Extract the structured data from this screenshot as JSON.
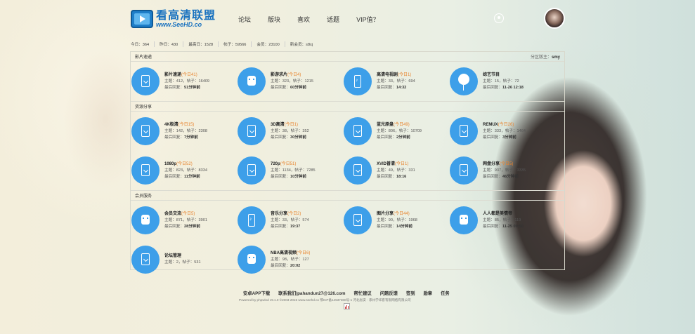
{
  "logo": {
    "cn": "看高清联盟",
    "en": "www.SeeHD.co"
  },
  "nav": [
    "论坛",
    "版块",
    "喜欢",
    "话题",
    "VIP值？"
  ],
  "stats": [
    "今日：364",
    "昨日：430",
    "最高日：1528",
    "帖子：59566",
    "会员：23100",
    "新会员：s8xj"
  ],
  "sections": [
    {
      "title": "影片速递",
      "moderator_label": "分区版主：",
      "moderator": "smy",
      "forums": [
        {
          "name": "影片速递",
          "today": "(今日41)",
          "counts": "主题：412，帖子：16409",
          "last_label": "最后回复：",
          "last": "51分钟前",
          "icon": "doc"
        },
        {
          "name": "影游求片",
          "today": "(今日4)",
          "counts": "主题：323，帖子：1215",
          "last_label": "最后回复：",
          "last": "60分钟前",
          "icon": "robot"
        },
        {
          "name": "高清电视剧",
          "today": "(今日1)",
          "counts": "主题：33，帖子：694",
          "last_label": "最后回复：",
          "last": "14:32",
          "icon": "phone"
        },
        {
          "name": "综艺节目",
          "today": "",
          "counts": "主题：15，帖子：72",
          "last_label": "最后回复：",
          "last": "11-26 12:18",
          "icon": "balloon"
        }
      ]
    },
    {
      "title": "资源分享",
      "moderator_label": "",
      "moderator": "",
      "forums": [
        {
          "name": "4K极清",
          "today": "(今日15)",
          "counts": "主题：142，帖子：2308",
          "last_label": "最后回复：",
          "last": "7分钟前",
          "icon": "doc"
        },
        {
          "name": "3D高清",
          "today": "(今日1)",
          "counts": "主题：38，帖子：352",
          "last_label": "最后回复：",
          "last": "30分钟前",
          "icon": "doc"
        },
        {
          "name": "蓝光原盘",
          "today": "(今日49)",
          "counts": "主题：806，帖子：10709",
          "last_label": "最后回复：",
          "last": "2分钟前",
          "icon": "doc"
        },
        {
          "name": "REMUX",
          "today": "(今日26)",
          "counts": "主题：333，帖子：1464",
          "last_label": "最后回复：",
          "last": "3分钟前",
          "icon": "doc"
        },
        {
          "name": "1080p",
          "today": "(今日52)",
          "counts": "主题：823，帖子：8334",
          "last_label": "最后回复：",
          "last": "11分钟前",
          "icon": "doc"
        },
        {
          "name": "720p",
          "today": "(今日51)",
          "counts": "主题：1134，帖子：7285",
          "last_label": "最后回复：",
          "last": "10分钟前",
          "icon": "doc"
        },
        {
          "name": "XVID普清",
          "today": "(今日1)",
          "counts": "主题：49，帖子：331",
          "last_label": "最后回复：",
          "last": "18:16",
          "icon": "doc"
        },
        {
          "name": "网盘分享",
          "today": "(今日5)",
          "counts": "主题：937，帖子：3335",
          "last_label": "最后回复：",
          "last": "46分钟前",
          "icon": "doc"
        }
      ]
    },
    {
      "title": "会员服务",
      "moderator_label": "",
      "moderator": "",
      "forums": [
        {
          "name": "会员交流",
          "today": "(今日5)",
          "counts": "主题：871，帖子：3901",
          "last_label": "最后回复：",
          "last": "28分钟前",
          "icon": "robot"
        },
        {
          "name": "音乐分享",
          "today": "(今日2)",
          "counts": "主题：33，帖子：574",
          "last_label": "最后回复：",
          "last": "19:37",
          "icon": "phone"
        },
        {
          "name": "图片分享",
          "today": "(今日44)",
          "counts": "主题：90，帖子：1968",
          "last_label": "最后回复：",
          "last": "14分钟前",
          "icon": "doc"
        },
        {
          "name": "人人都是美情帝",
          "today": "",
          "counts": "主题：85，帖子：119",
          "last_label": "最后回复：",
          "last": "11-25 09:50",
          "icon": "robot"
        },
        {
          "name": "论坛管理",
          "today": "",
          "counts": "主题：2，帖子：531",
          "last_label": "",
          "last": "",
          "icon": "doc"
        },
        {
          "name": "NBA高清视频",
          "today": "(今日6)",
          "counts": "主题：98，帖子：127",
          "last_label": "最后回复：",
          "last": "20:02",
          "icon": "robot"
        }
      ]
    }
  ],
  "footer": {
    "links": [
      "安卓APP下载",
      "联系我们|pahandun27@126.com",
      "帮忙建议",
      "问题反馈",
      "签到",
      "勋章",
      "任务"
    ],
    "note": "Powered by phpwind v9.1.0 ©2003-2015 www.seehd.co 鄂ICP备14537360号-1 河北省安 · 涿州学华客有限网络有限公司"
  },
  "colors": {
    "accent": "#3d9fe9",
    "today": "#e8842e",
    "logo": "#1b73c0"
  }
}
